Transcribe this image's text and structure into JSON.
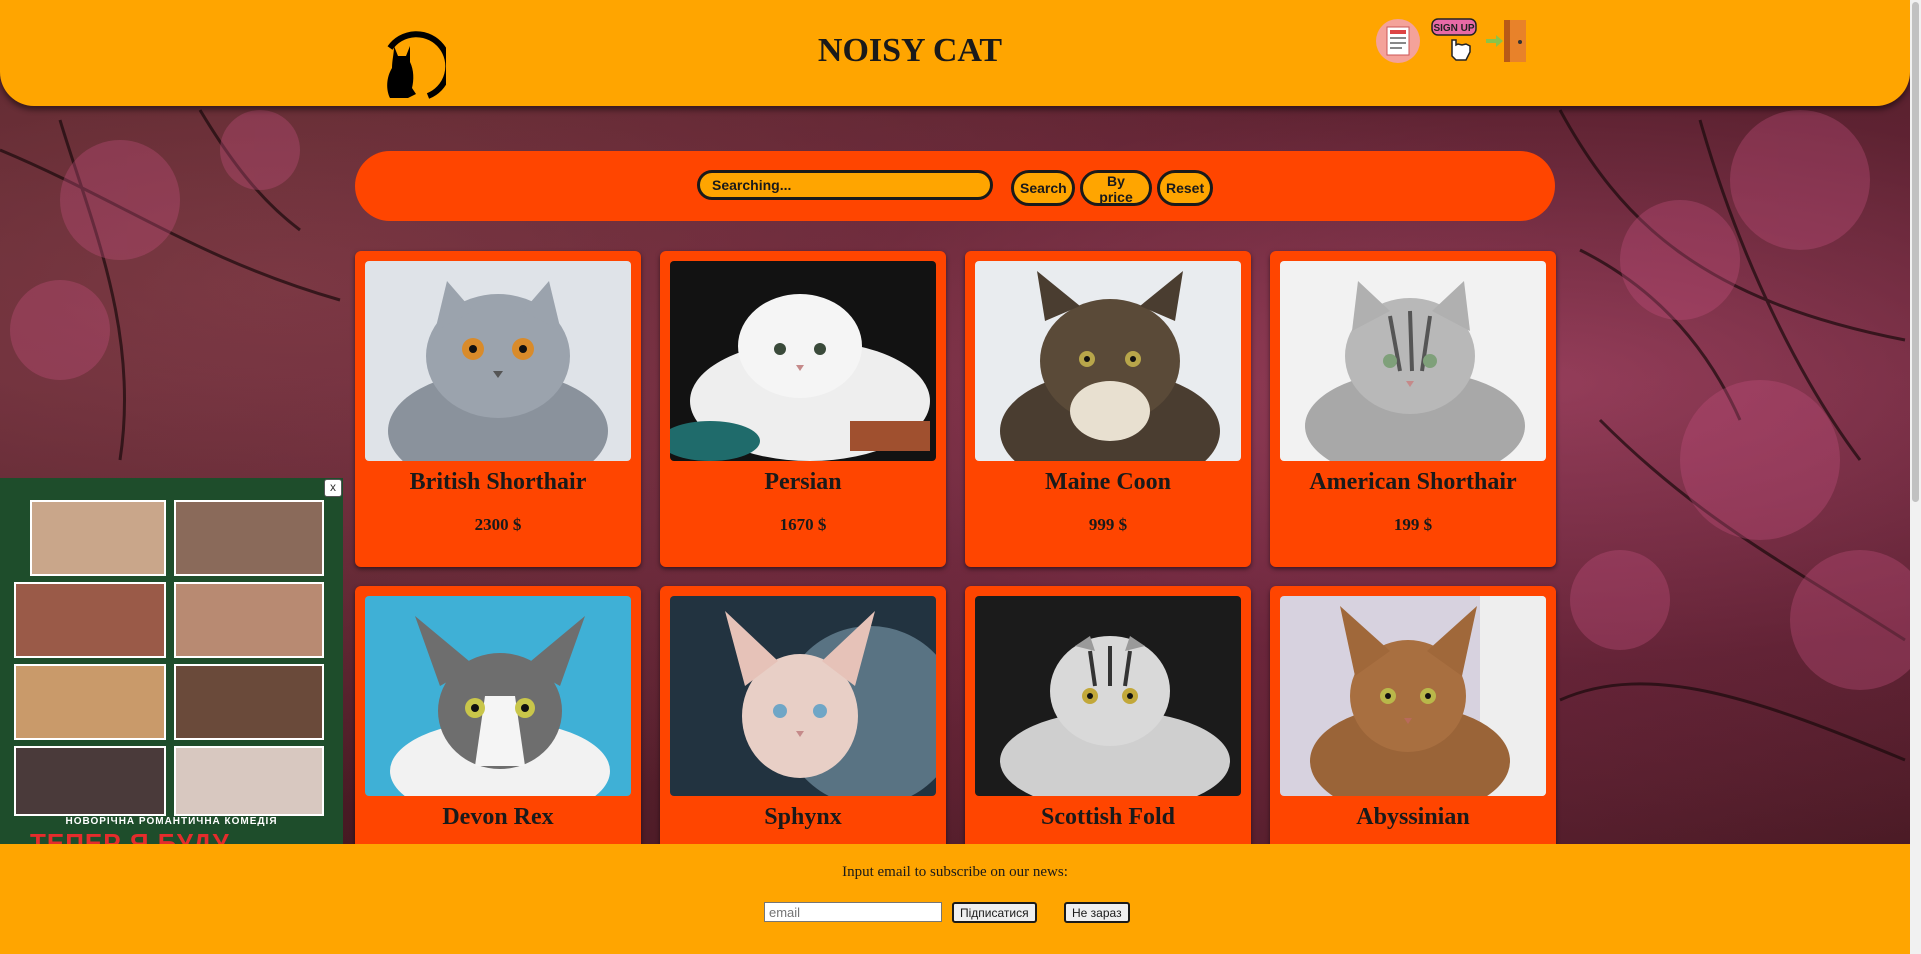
{
  "header": {
    "title": "NOISY CAT",
    "icons": [
      "cat-logo-icon",
      "news-icon",
      "signup-icon",
      "logout-icon"
    ],
    "signup_label": "SIGN UP"
  },
  "search": {
    "placeholder": "Searching...",
    "search_label": "Search",
    "by_price_label": "By price",
    "reset_label": "Reset"
  },
  "cats": [
    {
      "name": "British Shorthair",
      "price": "2300 $"
    },
    {
      "name": "Persian",
      "price": "1670 $"
    },
    {
      "name": "Maine Coon",
      "price": "999 $"
    },
    {
      "name": "American Shorthair",
      "price": "199 $"
    },
    {
      "name": "Devon Rex",
      "price": ""
    },
    {
      "name": "Sphynx",
      "price": ""
    },
    {
      "name": "Scottish Fold",
      "price": ""
    },
    {
      "name": "Abyssinian",
      "price": ""
    }
  ],
  "ad": {
    "close_label": "x",
    "subtitle": "НОВОРІЧНА РОМАНТИЧНА КОМЕДІЯ",
    "title": "ТЕПЕР Я БУДУ"
  },
  "footer": {
    "text": "Input email to subscribe on our news:",
    "email_placeholder": "email",
    "subscribe_label": "Підписатися",
    "later_label": "Не зараз"
  },
  "colors": {
    "header_bg": "#ffa500",
    "accent": "#ff4500",
    "text": "#1a1a1a"
  }
}
